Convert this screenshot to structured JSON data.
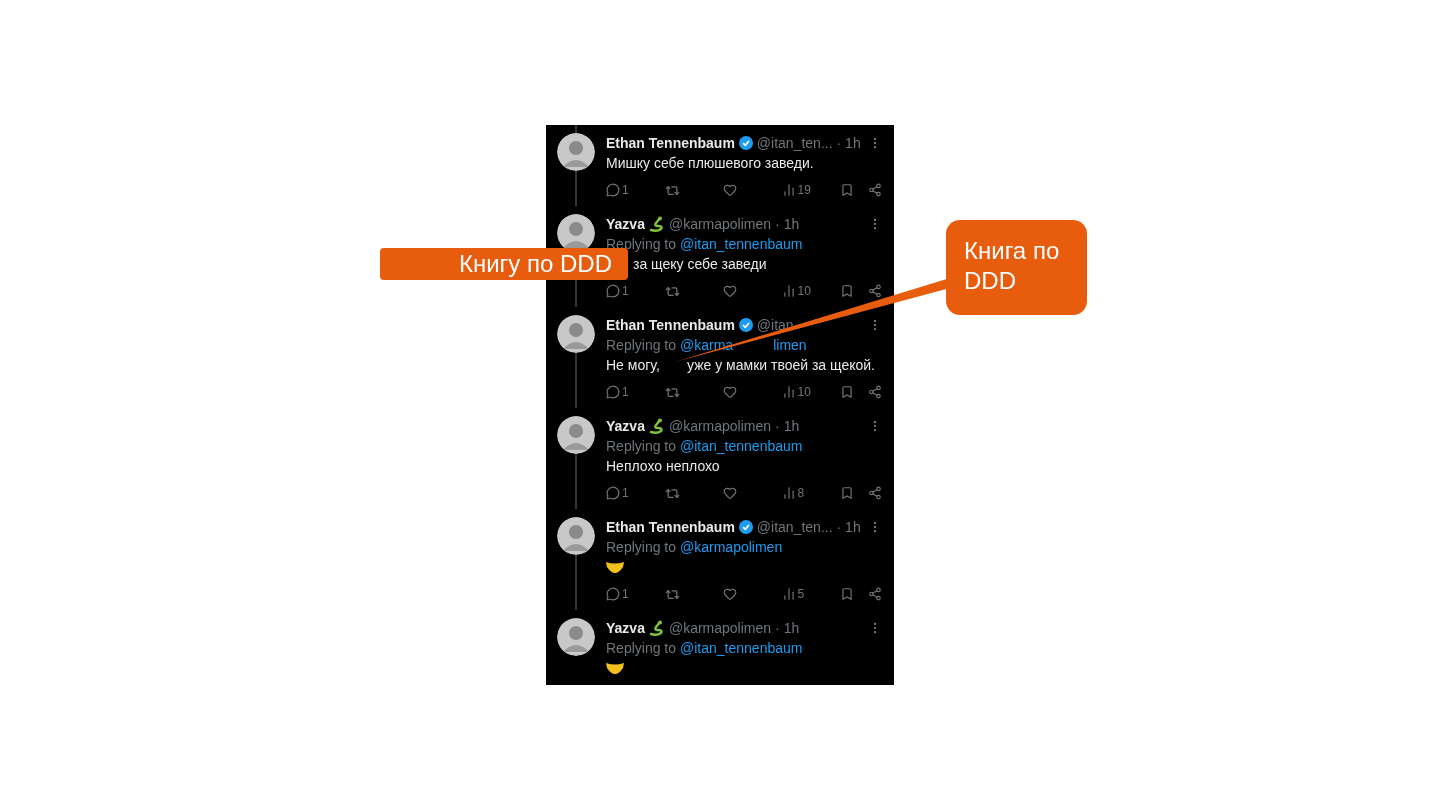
{
  "tweets": [
    {
      "name": "Ethan Tennenbaum",
      "verified": true,
      "snake": false,
      "handle": "@itan_ten...",
      "time": "· 1h",
      "body": {
        "kind": "text",
        "text": "Мишку себе плюшевого заведи."
      },
      "replies": "1",
      "views": "19"
    },
    {
      "name": "Yazva",
      "verified": false,
      "snake": true,
      "handle": "@karmapolimen",
      "time": "· 1h",
      "replying_prefix": "Replying to",
      "replying_to": "@itan_tennenbaum",
      "body": {
        "kind": "covered_start",
        "text": "за щеку себе заведи"
      },
      "replies": "1",
      "views": "10"
    },
    {
      "name": "Ethan Tennenbaum",
      "verified": true,
      "snake": false,
      "handle": "@itan",
      "replying_prefix": "Replying to",
      "replying_to": "@karma",
      "replying_to_tail": "limen",
      "body": {
        "kind": "text",
        "text": "Не могу,       уже у мамки твоей за щекой."
      },
      "replies": "1",
      "views": "10"
    },
    {
      "name": "Yazva",
      "verified": false,
      "snake": true,
      "handle": "@karmapolimen",
      "time": "· 1h",
      "replying_prefix": "Replying to",
      "replying_to": "@itan_tennenbaum",
      "body": {
        "kind": "text",
        "text": "Неплохо неплохо"
      },
      "replies": "1",
      "views": "8"
    },
    {
      "name": "Ethan Tennenbaum",
      "verified": true,
      "snake": false,
      "handle": "@itan_ten...",
      "time": "· 1h",
      "replying_prefix": "Replying to",
      "replying_to": "@karmapolimen",
      "body": {
        "kind": "emoji"
      },
      "replies": "1",
      "views": "5"
    },
    {
      "name": "Yazva",
      "verified": false,
      "snake": true,
      "handle": "@karmapolimen",
      "time": "· 1h",
      "replying_prefix": "Replying to",
      "replying_to": "@itan_tennenbaum",
      "body": {
        "kind": "emoji"
      }
    }
  ],
  "annotations": [
    {
      "kind": "label",
      "text": "Книгу по DDD"
    },
    {
      "kind": "callout",
      "text": "Книга по DDD"
    }
  ]
}
